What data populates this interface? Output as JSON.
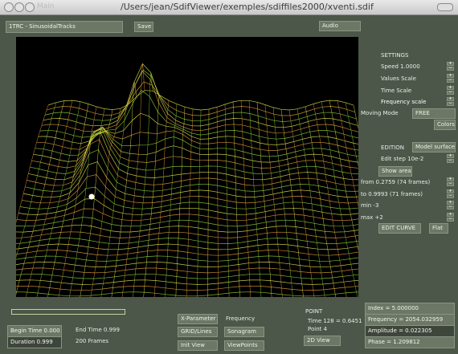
{
  "window": {
    "ghost_title": "Main",
    "title": "/Users/jean/SdifViewer/exemples/sdiffiles2000/xventi.sdif"
  },
  "top": {
    "track_label": "1TRC - SinusoidalTracks",
    "save_label": "Save",
    "audio_label": "Audio"
  },
  "settings": {
    "header": "SETTINGS",
    "speed": "Speed 1.0000",
    "values_scale": "Values Scale",
    "time_scale": "Time Scale",
    "frequency_scale": "Frequency scale",
    "moving_mode_label": "Moving Mode",
    "moving_mode_value": "FREE",
    "colors_label": "Colors"
  },
  "edition": {
    "header": "EDITION",
    "model_label": "Model surface",
    "edit_step": "Edit step 10e-2",
    "show_area_label": "Show area",
    "from": "from 0.2759 (74 frames)",
    "to": "to 0.9993 (71 frames)",
    "min": "min -3",
    "max": "max +2",
    "edit_curve_label": "EDIT CURVE",
    "flat_label": "Flat"
  },
  "bottom": {
    "begin_time": "Begin Time 0.000",
    "end_time": "End Time 0.999",
    "duration": "Duration 0.999",
    "frames": "200 Frames",
    "x_parameter_label": "X-Parameter",
    "x_parameter_value": "Frequency",
    "grid_lines_label": "GRID/Lines",
    "sonagram_label": "Sonagram",
    "init_view_label": "Init View",
    "view_points_label": "ViewPoints",
    "point_header": "POINT",
    "point_time": "Time 128 = 0.6451",
    "point_index": "Point 4",
    "view_2d_label": "2D View"
  },
  "readout": {
    "index": "Index = 5.000000",
    "frequency": "Frequency = 2054.032959",
    "amplitude": "Amplitude = 0.022305",
    "phase": "Phase = 1.209812"
  },
  "colors": {
    "background": "#4c5749",
    "button": "#6c7765",
    "surface_yellow": "#e3e84a",
    "surface_orange": "#e8a038",
    "surface_green": "#8fd13a"
  }
}
